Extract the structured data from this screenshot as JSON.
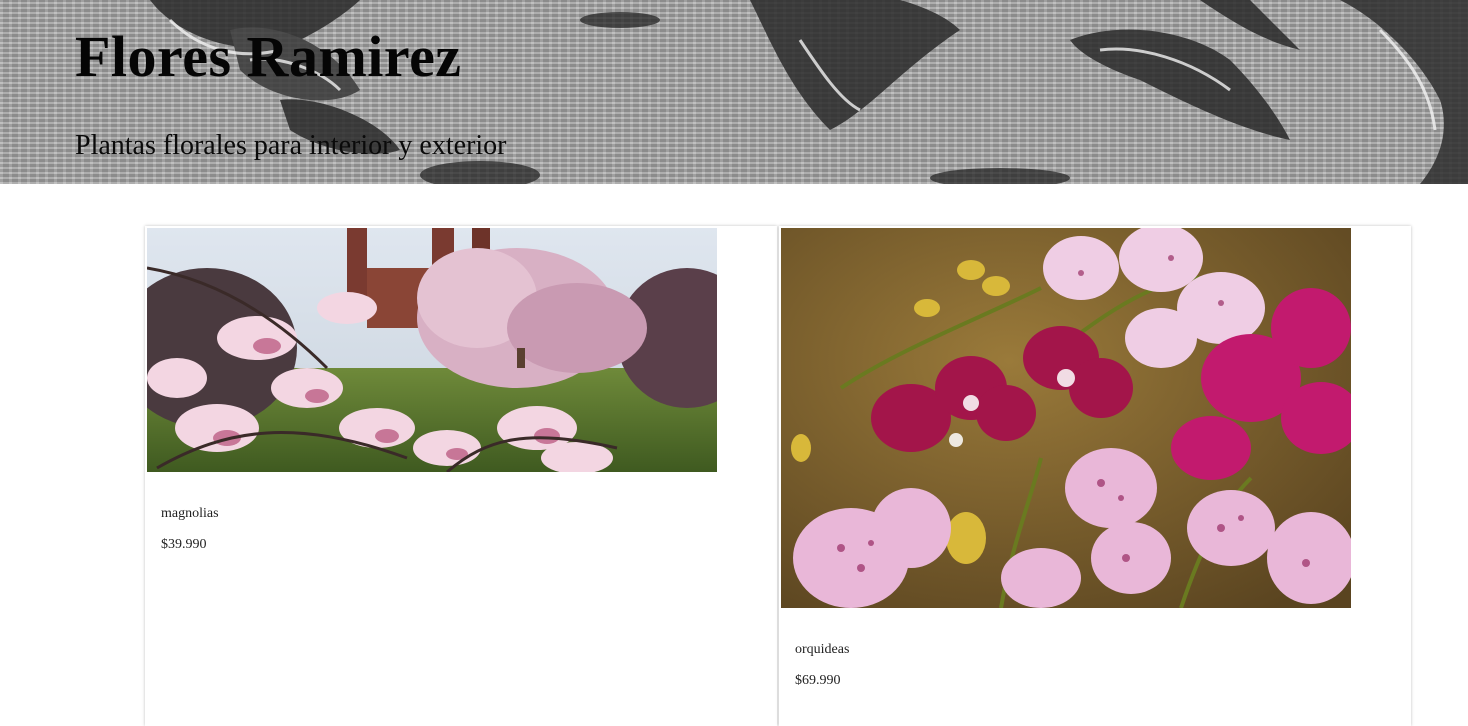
{
  "header": {
    "title": "Flores Ramirez",
    "subtitle": "Plantas florales para interior y exterior"
  },
  "products": [
    {
      "name": "magnolias",
      "price": "$39.990",
      "image": "magnolia-garden-photo"
    },
    {
      "name": "orquideas",
      "price": "$69.990",
      "image": "orchid-flowers-photo"
    }
  ],
  "colors": {
    "background": "#ffffff",
    "text": "#111111",
    "banner_tone": "#a9a9a9"
  }
}
